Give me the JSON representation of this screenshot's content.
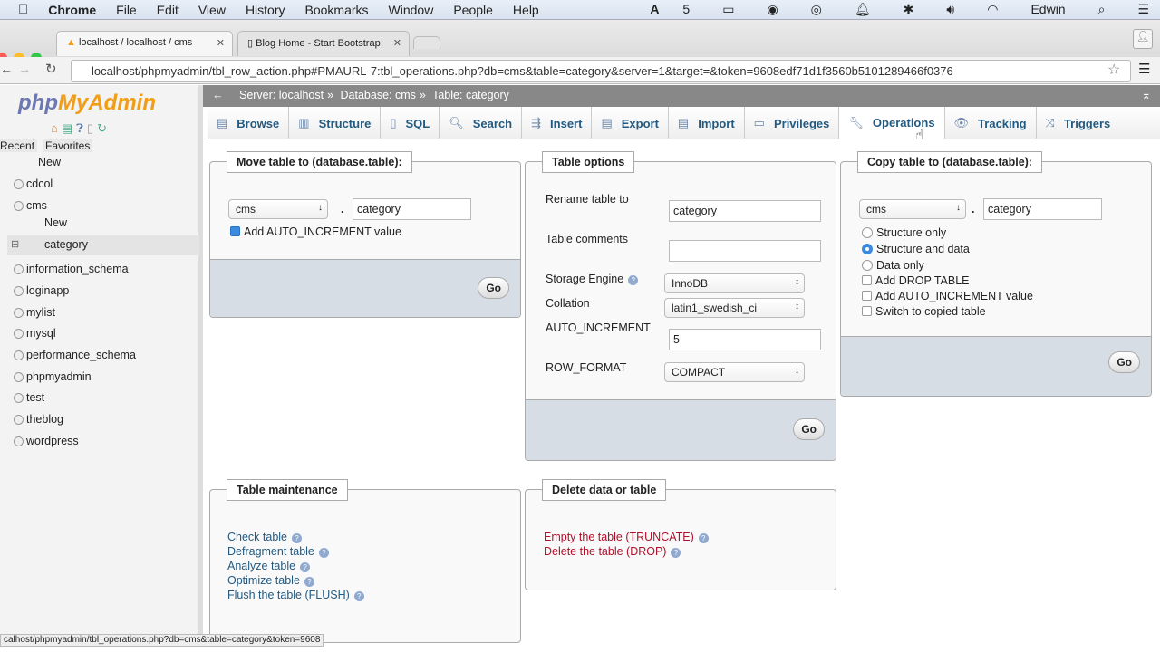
{
  "menubar": {
    "app": "Chrome",
    "items": [
      "File",
      "Edit",
      "View",
      "History",
      "Bookmarks",
      "Window",
      "People",
      "Help"
    ],
    "right": {
      "adobe": "5",
      "user": "Edwin"
    }
  },
  "browser": {
    "tabs": [
      {
        "title": "localhost / localhost / cms"
      },
      {
        "title": "Blog Home - Start Bootstrap"
      }
    ],
    "url": "localhost/phpmyadmin/tbl_row_action.php#PMAURL-7:tbl_operations.php?db=cms&table=category&server=1&target=&token=9608edf71d1f3560b5101289466f0376"
  },
  "sidebar": {
    "logo_php": "php",
    "logo_my": "MyAdmin",
    "tabs": [
      "Recent",
      "Favorites"
    ],
    "tree": [
      {
        "label": "New"
      },
      {
        "label": "cdcol"
      },
      {
        "label": "cms"
      },
      {
        "label": "New"
      },
      {
        "label": "category"
      },
      {
        "label": "information_schema"
      },
      {
        "label": "loginapp"
      },
      {
        "label": "mylist"
      },
      {
        "label": "mysql"
      },
      {
        "label": "performance_schema"
      },
      {
        "label": "phpmyadmin"
      },
      {
        "label": "test"
      },
      {
        "label": "theblog"
      },
      {
        "label": "wordpress"
      }
    ]
  },
  "breadcrumb": {
    "server": "Server: localhost",
    "database": "Database: cms",
    "table": "Table: category",
    "sep": "»"
  },
  "nav_tabs": [
    {
      "label": "Browse",
      "icon": "browse-icon"
    },
    {
      "label": "Structure",
      "icon": "structure-icon"
    },
    {
      "label": "SQL",
      "icon": "sql-icon"
    },
    {
      "label": "Search",
      "icon": "search-icon"
    },
    {
      "label": "Insert",
      "icon": "insert-icon"
    },
    {
      "label": "Export",
      "icon": "export-icon"
    },
    {
      "label": "Import",
      "icon": "import-icon"
    },
    {
      "label": "Privileges",
      "icon": "privileges-icon"
    },
    {
      "label": "Operations",
      "icon": "wrench-icon",
      "active": true
    },
    {
      "label": "Tracking",
      "icon": "eye-icon"
    },
    {
      "label": "Triggers",
      "icon": "triggers-icon"
    }
  ],
  "move": {
    "legend": "Move table to (database.table):",
    "db": "cms",
    "dot": ".",
    "table": "category",
    "auto_inc": "Add AUTO_INCREMENT value",
    "auto_inc_checked": true,
    "go": "Go"
  },
  "options": {
    "legend": "Table options",
    "rename_label": "Rename table to",
    "rename_value": "category",
    "comments_label": "Table comments",
    "comments_value": "",
    "engine_label": "Storage Engine",
    "engine": "InnoDB",
    "collation_label": "Collation",
    "collation": "latin1_swedish_ci",
    "autoinc_label": "AUTO_INCREMENT",
    "autoinc": "5",
    "rowformat_label": "ROW_FORMAT",
    "rowformat": "COMPACT",
    "go": "Go"
  },
  "copy": {
    "legend": "Copy table to (database.table):",
    "db": "cms",
    "dot": ".",
    "table": "category",
    "radios": [
      "Structure only",
      "Structure and data",
      "Data only"
    ],
    "selected": "Structure and data",
    "checks": [
      "Add DROP TABLE",
      "Add AUTO_INCREMENT value",
      "Switch to copied table"
    ],
    "go": "Go"
  },
  "maintenance": {
    "legend": "Table maintenance",
    "links": [
      "Check table",
      "Defragment table",
      "Analyze table",
      "Optimize table",
      "Flush the table (FLUSH)"
    ]
  },
  "delete": {
    "legend": "Delete data or table",
    "links": [
      "Empty the table (TRUNCATE)",
      "Delete the table (DROP)"
    ]
  },
  "status_url": "calhost/phpmyadmin/tbl_operations.php?db=cms&table=category&token=9608"
}
